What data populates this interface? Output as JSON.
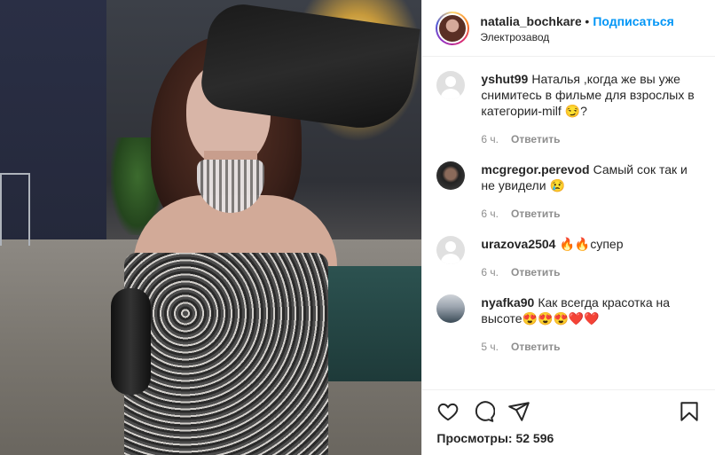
{
  "header": {
    "username": "natalia_bochkare",
    "separator": "•",
    "follow_label": "Подписаться",
    "location": "Электрозавод"
  },
  "comments": [
    {
      "user": "yshut99",
      "text": "Наталья ,когда же вы уже снимитесь в фильме для взрослых в категории-milf 😏?",
      "time": "6 ч.",
      "reply": "Ответить",
      "avatar": "default-avatar"
    },
    {
      "user": "mcgregor.perevod",
      "text": "Самый сок так и не увидели 😢",
      "time": "6 ч.",
      "reply": "Ответить",
      "avatar": "photo-avatar"
    },
    {
      "user": "urazova2504",
      "text": "🔥🔥супер",
      "time": "6 ч.",
      "reply": "Ответить",
      "avatar": "default-avatar"
    },
    {
      "user": "nyafka90",
      "text": "Как всегда красотка на высоте😍😍😍❤️❤️",
      "time": "5 ч.",
      "reply": "Ответить",
      "avatar": "photo-avatar"
    }
  ],
  "actions": {
    "icons": [
      "heart-icon",
      "comment-icon",
      "share-icon",
      "bookmark-icon"
    ],
    "views_label": "Просмотры: 52 596"
  },
  "colors": {
    "accent": "#0095f6",
    "text": "#262626",
    "muted": "#8e8e8e",
    "border": "#efefef"
  }
}
